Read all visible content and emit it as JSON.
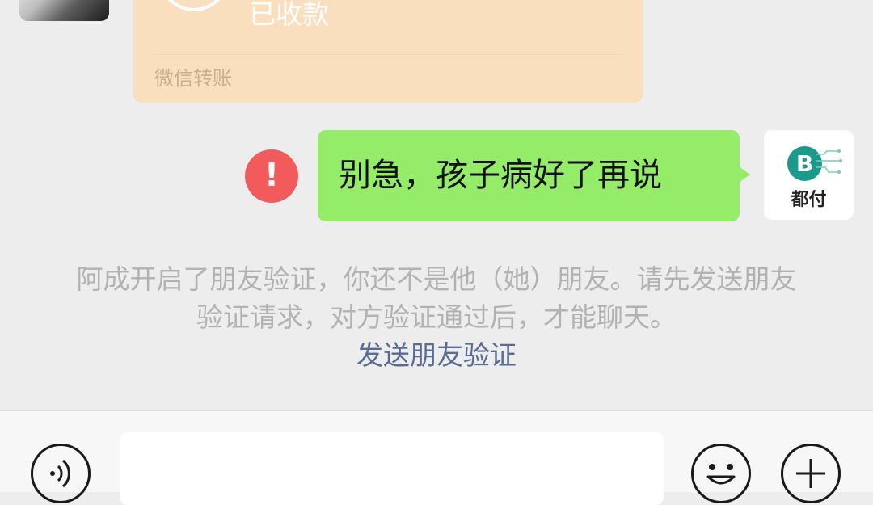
{
  "transfer": {
    "status": "已收款",
    "label": "微信转账",
    "accent_color": "#fadfbf"
  },
  "message": {
    "text": "别急，孩子病好了再说",
    "error_indicator": "!",
    "bubble_color": "#95ec69",
    "error_color": "#f25b5b"
  },
  "sender_avatar": {
    "logo_text": "B",
    "brand": "都付",
    "logo_color": "#1b9a8c"
  },
  "notice": {
    "text": "阿成开启了朋友验证，你还不是他（她）朋友。请先发送朋友验证请求，对方验证通过后，才能聊天。",
    "link_text": "发送朋友验证",
    "link_color": "#576b95"
  },
  "input_bar": {
    "voice_icon": "voice-icon",
    "emoji_icon": "emoji-icon",
    "plus_icon": "plus-icon"
  }
}
